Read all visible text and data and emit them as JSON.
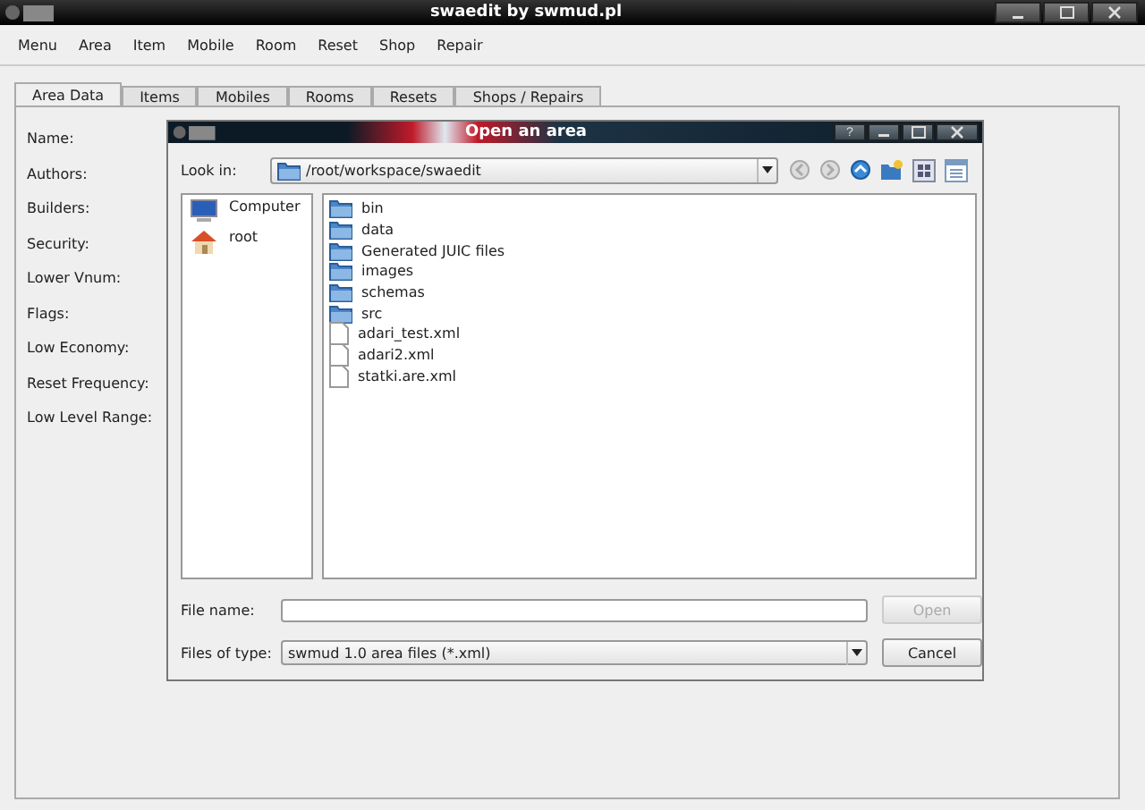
{
  "window": {
    "title": "swaedit by swmud.pl"
  },
  "menu": [
    "Menu",
    "Area",
    "Item",
    "Mobile",
    "Room",
    "Reset",
    "Shop",
    "Repair"
  ],
  "tabs": [
    {
      "label": "Area Data",
      "selected": true
    },
    {
      "label": "Items",
      "selected": false
    },
    {
      "label": "Mobiles",
      "selected": false
    },
    {
      "label": "Rooms",
      "selected": false
    },
    {
      "label": "Resets",
      "selected": false
    },
    {
      "label": "Shops / Repairs",
      "selected": false
    }
  ],
  "fields": [
    "Name:",
    "Authors:",
    "Builders:",
    "Security:",
    "Lower Vnum:",
    "Flags:",
    "Low Economy:",
    "Reset Frequency:",
    "Low Level Range:"
  ],
  "dialog": {
    "title": "Open an area",
    "help": "?",
    "look_in_label": "Look in:",
    "look_in": "/root/workspace/swaedit",
    "places": [
      {
        "kind": "computer",
        "name": "Computer"
      },
      {
        "kind": "home",
        "name": "root"
      }
    ],
    "files": [
      {
        "kind": "folder",
        "name": "bin"
      },
      {
        "kind": "folder",
        "name": "data"
      },
      {
        "kind": "folder",
        "name": "Generated JUIC files"
      },
      {
        "kind": "folder",
        "name": "images"
      },
      {
        "kind": "folder",
        "name": "schemas"
      },
      {
        "kind": "folder",
        "name": "src"
      },
      {
        "kind": "file",
        "name": "adari_test.xml"
      },
      {
        "kind": "file",
        "name": "adari2.xml"
      },
      {
        "kind": "file",
        "name": "statki.are.xml"
      }
    ],
    "file_name_label": "File name:",
    "file_type_label": "Files of type:",
    "file_type": "swmud 1.0 area files (*.xml)",
    "open_button": {
      "label": "Open",
      "disabled": true
    },
    "cancel_button": {
      "label": "Cancel",
      "disabled": false
    }
  }
}
